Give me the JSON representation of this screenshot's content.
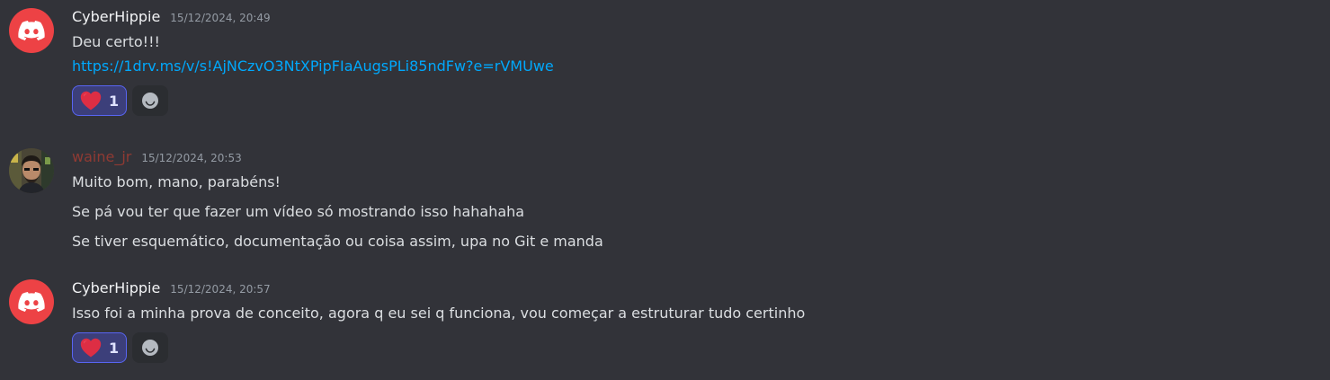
{
  "messages": [
    {
      "author": "CyberHippie",
      "timestamp": "15/12/2024, 20:49",
      "lines": [
        "Deu certo!!!"
      ],
      "link": "https://1drv.ms/v/s!AjNCzvO3NtXPipFIaAugsPLi85ndFw?e=rVMUwe",
      "reaction": {
        "emoji": "heart-icon",
        "count": "1"
      }
    },
    {
      "author": "waine_jr",
      "timestamp": "15/12/2024, 20:53",
      "lines": [
        "Muito bom, mano, parabéns!",
        "Se pá vou ter que fazer um vídeo só mostrando isso hahahaha",
        "Se tiver esquemático, documentação ou coisa assim, upa no Git e manda"
      ]
    },
    {
      "author": "CyberHippie",
      "timestamp": "15/12/2024, 20:57",
      "lines": [
        "Isso foi a minha prova de conceito, agora q eu sei q funciona, vou começar a estruturar tudo certinho"
      ],
      "reaction": {
        "emoji": "heart-icon",
        "count": "1"
      }
    }
  ],
  "colors": {
    "background": "#323339",
    "discord_red": "#ed4245",
    "username_red": "#8f3a33",
    "link": "#00a8fc",
    "reaction_active_bg": "#3c3f7a",
    "reaction_active_border": "#5865f2"
  }
}
